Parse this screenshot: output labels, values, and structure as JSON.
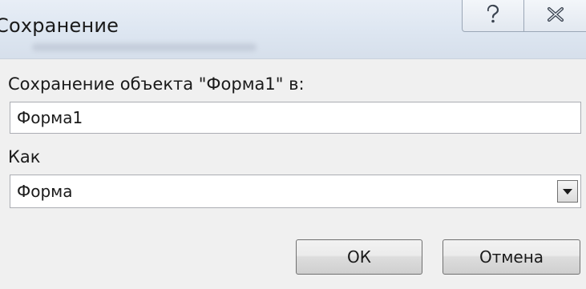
{
  "window": {
    "title": "Сохранение",
    "help_icon": "question-mark-icon",
    "close_icon": "close-x-icon"
  },
  "form": {
    "save_label": "Сохранение объекта \"Форма1\" в:",
    "name_value": "Форма1",
    "as_label": "Как",
    "type_selected": "Форма"
  },
  "buttons": {
    "ok_label": "ОК",
    "cancel_label": "Отмена"
  }
}
